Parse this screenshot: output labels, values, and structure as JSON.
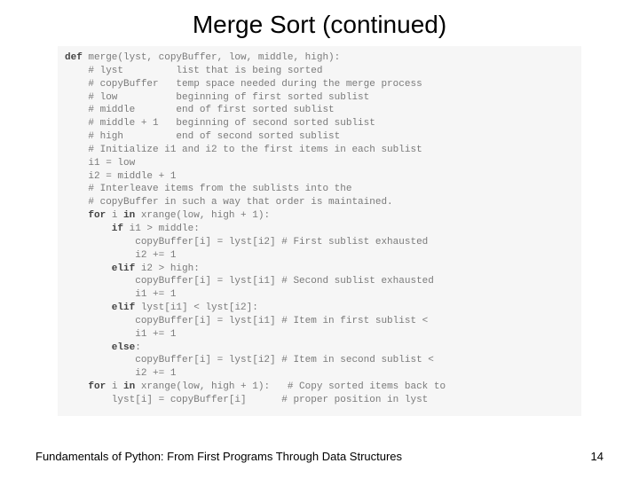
{
  "title": "Merge Sort (continued)",
  "footer": "Fundamentals of Python: From First Programs Through Data Structures",
  "page_number": "14",
  "code": {
    "l01a": "def ",
    "l01b": "merge(lyst, copyBuffer, low, middle, high):",
    "l02": "    # lyst         list that is being sorted",
    "l03": "    # copyBuffer   temp space needed during the merge process",
    "l04": "    # low          beginning of first sorted sublist",
    "l05": "    # middle       end of first sorted sublist",
    "l06": "    # middle + 1   beginning of second sorted sublist",
    "l07": "    # high         end of second sorted sublist",
    "l08": "",
    "l09": "    # Initialize i1 and i2 to the first items in each sublist",
    "l10": "    i1 = low",
    "l11": "    i2 = middle + 1",
    "l12": "",
    "l13": "    # Interleave items from the sublists into the",
    "l14": "    # copyBuffer in such a way that order is maintained.",
    "l15a": "    for ",
    "l15b": "i ",
    "l15c": "in ",
    "l15d": "xrange(low, high + 1):",
    "l16a": "        if ",
    "l16b": "i1 > middle:",
    "l17": "            copyBuffer[i] = lyst[i2] # First sublist exhausted",
    "l18": "            i2 += 1",
    "l19a": "        elif ",
    "l19b": "i2 > high:",
    "l20": "            copyBuffer[i] = lyst[i1] # Second sublist exhausted",
    "l21": "            i1 += 1",
    "l22a": "        elif ",
    "l22b": "lyst[i1] < lyst[i2]:",
    "l23": "            copyBuffer[i] = lyst[i1] # Item in first sublist <",
    "l24": "            i1 += 1",
    "l25a": "        else",
    "l25b": ":",
    "l26": "            copyBuffer[i] = lyst[i2] # Item in second sublist <",
    "l27": "            i2 += 1",
    "l28": "",
    "l29a": "    for ",
    "l29b": "i ",
    "l29c": "in ",
    "l29d": "xrange(low, high + 1):   # Copy sorted items back to",
    "l30": "        lyst[i] = copyBuffer[i]      # proper position in lyst"
  }
}
